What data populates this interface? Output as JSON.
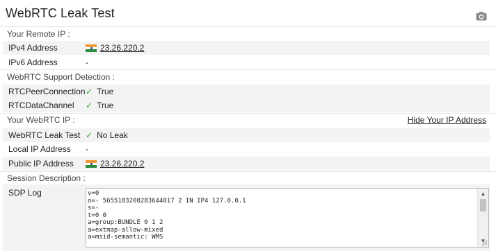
{
  "header": {
    "title": "WebRTC Leak Test",
    "screenshot_icon": "camera-icon"
  },
  "remote_ip": {
    "section_label": "Your Remote IP :",
    "rows": [
      {
        "label": "IPv4 Address",
        "value": "23.26.220.2",
        "flag": "india-flag-icon"
      },
      {
        "label": "IPv6 Address",
        "value": "-"
      }
    ]
  },
  "support": {
    "section_label": "WebRTC Support Detection :",
    "rows": [
      {
        "label": "RTCPeerConnection",
        "value": "True",
        "check_icon": "check-icon"
      },
      {
        "label": "RTCDataChannel",
        "value": "True",
        "check_icon": "check-icon"
      }
    ]
  },
  "webrtc_ip": {
    "section_label": "Your WebRTC IP :",
    "hide_link": "Hide Your IP Address",
    "rows": [
      {
        "label": "WebRTC Leak Test",
        "value": "No Leak",
        "check_icon": "check-icon"
      },
      {
        "label": "Local IP Address",
        "value": "-"
      },
      {
        "label": "Public IP Address",
        "value": "23.26.220.2",
        "flag": "india-flag-icon"
      }
    ]
  },
  "session": {
    "section_label": "Session Description :",
    "sdp_label": "SDP Log",
    "sdp_lines": [
      "v=0",
      "o=- 5655183208283644017 2 IN IP4 127.0.0.1",
      "s=-",
      "t=0 0",
      "a=group:BUNDLE 0 1 2",
      "a=extmap-allow-mixed",
      "a=msid-semantic: WMS"
    ]
  },
  "colors": {
    "check": "#3aa835",
    "row_bg": "#f3f3f3"
  }
}
